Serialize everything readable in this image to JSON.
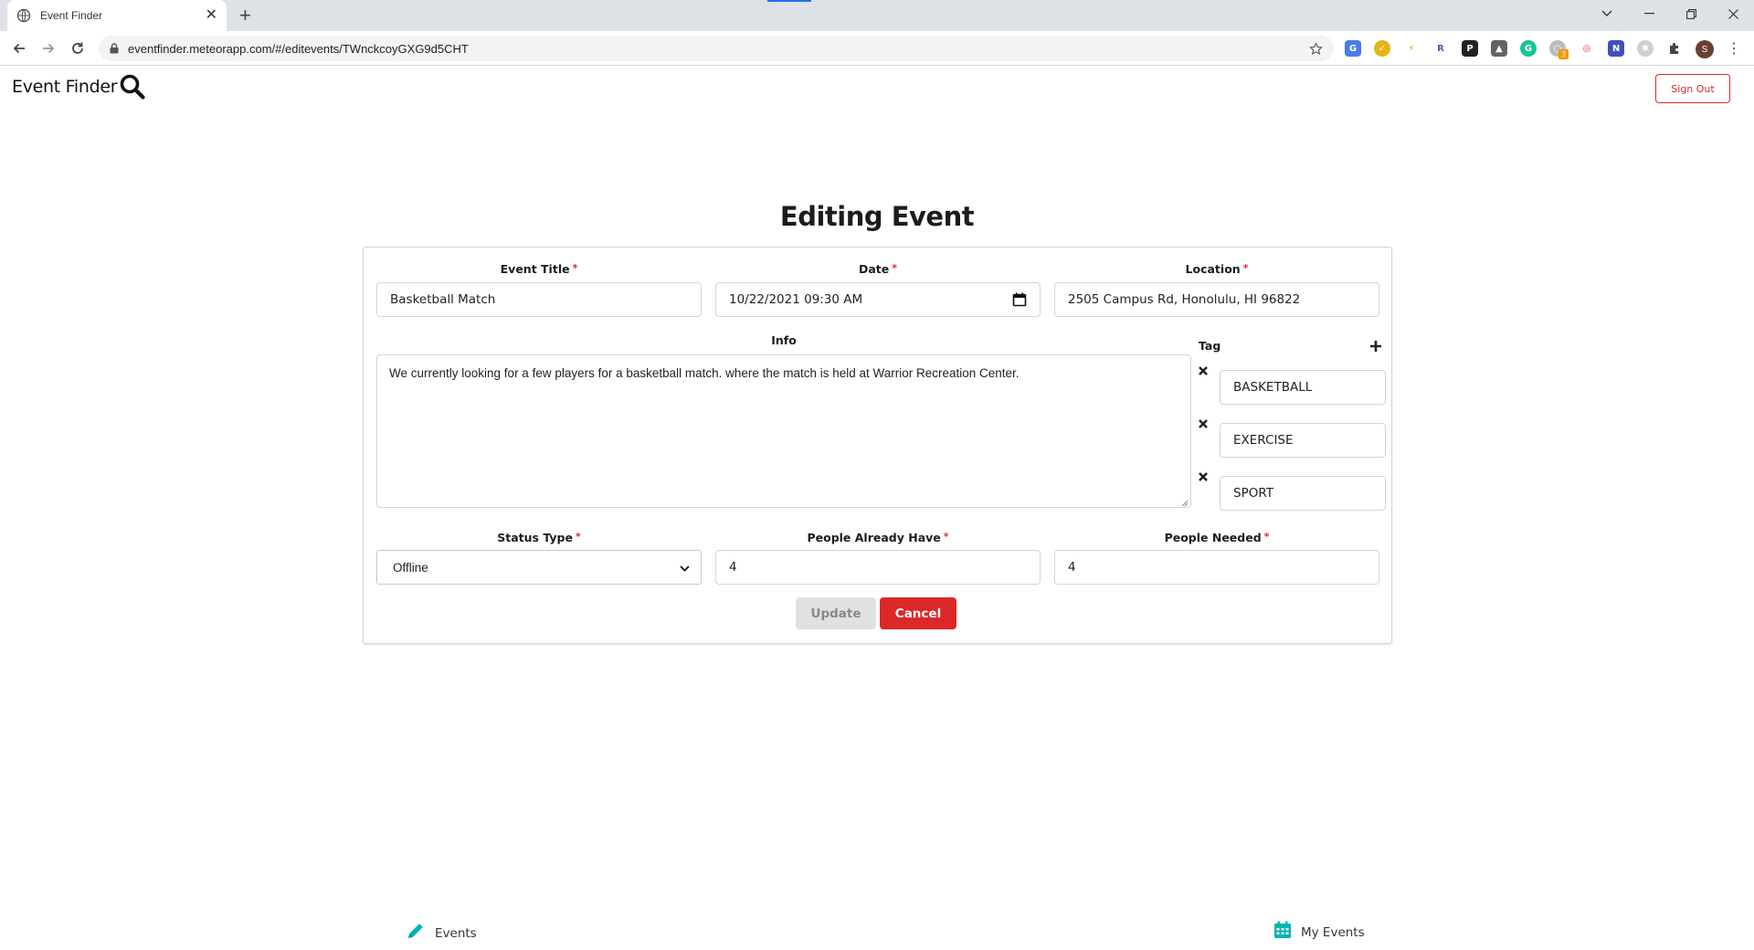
{
  "browser": {
    "tab_title": "Event Finder",
    "url": "eventfinder.meteorapp.com/#/editevents/TWnckcoyGXG9d5CHT",
    "profile_initial": "S",
    "extension_badge": "3"
  },
  "navbar": {
    "brand": "Event Finder",
    "signout_label": "Sign Out"
  },
  "page": {
    "title": "Editing Event"
  },
  "form": {
    "event_title": {
      "label": "Event Title",
      "required_mark": "*",
      "value": "Basketball Match"
    },
    "date": {
      "label": "Date",
      "required_mark": "*",
      "value": "10/22/2021 09:30 AM"
    },
    "location": {
      "label": "Location",
      "required_mark": "*",
      "value": "2505 Campus Rd, Honolulu, HI 96822"
    },
    "info": {
      "label": "Info",
      "value": "We currently looking for a few players for a basketball match. where the match is held at Warrior Recreation Center."
    },
    "tag": {
      "label": "Tag",
      "items": [
        "BASKETBALL",
        "EXERCISE",
        "SPORT"
      ]
    },
    "status_type": {
      "label": "Status Type",
      "required_mark": "*",
      "value": "Offline"
    },
    "people_already_have": {
      "label": "People Already Have",
      "required_mark": "*",
      "value": "4"
    },
    "people_needed": {
      "label": "People Needed",
      "required_mark": "*",
      "value": "4"
    },
    "update_label": "Update",
    "cancel_label": "Cancel"
  },
  "footer": {
    "events_label": "Events",
    "my_events_label": "My Events"
  },
  "colors": {
    "accent_red": "#db2828",
    "teal_icon": "#00b5ad",
    "disabled_button": "#e0e1e2"
  },
  "icons": [
    "globe-icon",
    "close-icon",
    "plus-icon",
    "back-icon",
    "forward-icon",
    "reload-icon",
    "lock-icon",
    "star-icon",
    "search-icon",
    "calendar-icon",
    "chevron-down-icon",
    "times-icon",
    "pencil-icon",
    "calendar-alt-icon",
    "puzzle-icon"
  ]
}
